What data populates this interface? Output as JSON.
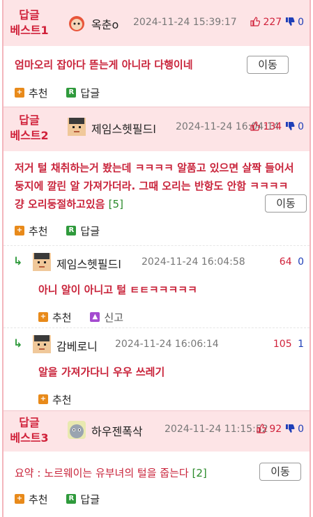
{
  "bests": [
    {
      "label_line1": "답글",
      "label_line2": "베스트1",
      "nick": "옥춘o",
      "date": "2024-11-24 15:39:17",
      "up": "227",
      "down": "0",
      "text": "엄마오리 잡아다 뜯는게 아니라 다행이네",
      "move_label": "이동",
      "recommend_label": "추천",
      "reply_label": "답글"
    },
    {
      "label_line1": "답글",
      "label_line2": "베스트2",
      "nick": "제임스헷필드l",
      "date": "2024-11-24 16:04:14",
      "up": "134",
      "down": "0",
      "text": "저거 털 채취하는거 봤는데 ㅋㅋㅋㅋ 알품고 있으면 살짝 들어서 둥지에 깔린 알 가져가더라. 그때 오리는 반항도 안함 ㅋㅋㅋㅋ 걍 오리둥절하고있음",
      "reply_count": "[5]",
      "move_label": "이동",
      "recommend_label": "추천",
      "reply_label": "답글",
      "replies": [
        {
          "nick": "제임스헷필드l",
          "date": "2024-11-24 16:04:58",
          "up": "64",
          "down": "0",
          "text": "아니 알이 아니고 털 ㅌㅌㅋㅋㅋㅋㅋ",
          "recommend_label": "추천",
          "report_label": "신고"
        },
        {
          "nick": "감베로니",
          "date": "2024-11-24 16:06:14",
          "up": "105",
          "down": "1",
          "text": "알을 가져가다니 우우 쓰레기",
          "recommend_label": "추천"
        }
      ]
    },
    {
      "label_line1": "답글",
      "label_line2": "베스트3",
      "nick": "하우젠폭삭",
      "date": "2024-11-24 11:15:52",
      "up": "92",
      "down": "0",
      "text": "요약 : 노르웨이는 유부녀의 털을 줍는다",
      "reply_count": "[2]",
      "move_label": "이동",
      "recommend_label": "추천",
      "reply_label": "답글"
    }
  ],
  "colors": {
    "accent_red": "#d0213a",
    "header_bg": "#fde4e6",
    "down_blue": "#1f3fb8",
    "green": "#2f9a3c"
  },
  "icons": {
    "up": "thumbs-up-icon",
    "down": "thumbs-down-icon",
    "reply_arrow": "reply-arrow-icon",
    "recommend": "plus-icon",
    "reply": "reply-r-icon",
    "report": "bell-icon"
  }
}
